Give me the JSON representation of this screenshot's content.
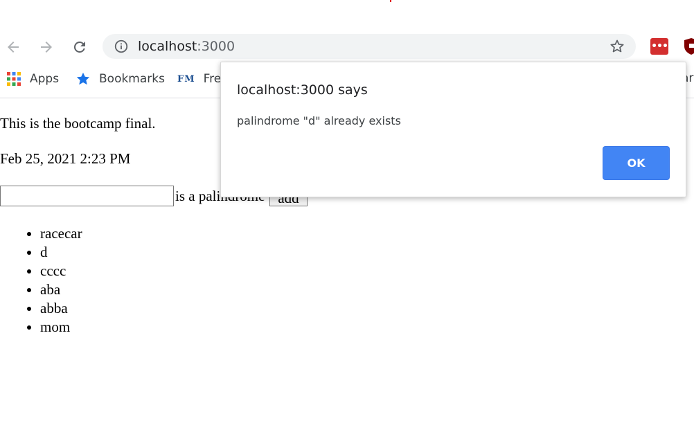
{
  "browser": {
    "url_host": "localhost",
    "url_port": ":3000",
    "icons": {
      "back": "arrow-left-icon",
      "forward": "arrow-right-icon",
      "reload": "reload-icon",
      "info": "info-icon",
      "bookmark": "star-outline-icon",
      "ext1": "lastpass-icon",
      "ext2": "ublock-icon"
    },
    "ext1_glyph": "•••"
  },
  "bookmarks_bar": {
    "items": [
      {
        "label": "Apps",
        "icon": "apps-grid-icon"
      },
      {
        "label": "Bookmarks",
        "icon": "star-filled-icon"
      },
      {
        "label": "Fre",
        "icon": "fm-logo-icon",
        "icon_text": "FM"
      }
    ],
    "clipped_right": "ar"
  },
  "page": {
    "intro": "This is the bootcamp final.",
    "date": "Feb 25, 2021 2:23 PM",
    "input_value": "",
    "label": "is a palindrome",
    "add_button": "add",
    "palindromes": [
      "racecar",
      "d",
      "cccc",
      "aba",
      "abba",
      "mom"
    ]
  },
  "dialog": {
    "title": "localhost:3000 says",
    "message": "palindrome \"d\" already exists",
    "ok_label": "OK"
  },
  "colors": {
    "accent": "#4285f4",
    "omnibox": "#f1f3f4",
    "ext_red": "#d32f2f"
  }
}
